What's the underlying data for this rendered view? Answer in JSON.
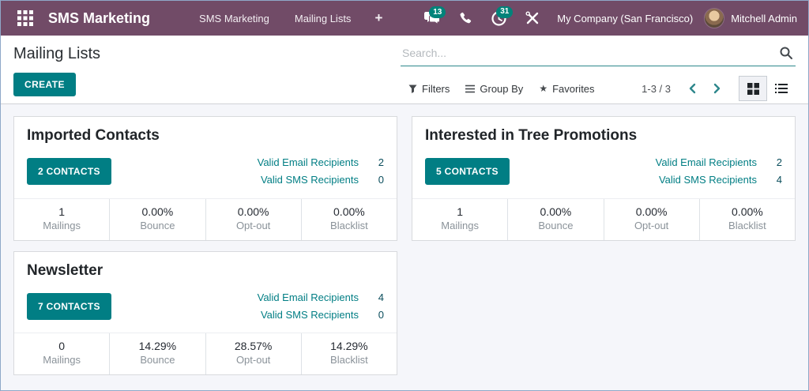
{
  "icons": {
    "plus": "+",
    "star": "★"
  },
  "colors": {
    "header_bg": "#714B67",
    "accent_teal": "#017E84",
    "badge_teal": "#00837A",
    "content_bg": "#F5F6FA"
  },
  "header": {
    "app_name": "SMS Marketing",
    "menu_items": [
      {
        "label": "SMS Marketing"
      },
      {
        "label": "Mailing Lists"
      }
    ],
    "messages_badge": "13",
    "activities_badge": "31",
    "company": "My Company (San Francisco)",
    "user": "Mitchell Admin"
  },
  "control_panel": {
    "title": "Mailing Lists",
    "create_label": "CREATE",
    "search_placeholder": "Search...",
    "filters_label": "Filters",
    "group_by_label": "Group By",
    "favorites_label": "Favorites",
    "pager": "1-3 / 3"
  },
  "cards": [
    {
      "title": "Imported Contacts",
      "contacts_label": "2 CONTACTS",
      "valid_email_label": "Valid Email Recipients",
      "valid_email_value": "2",
      "valid_sms_label": "Valid SMS Recipients",
      "valid_sms_value": "0",
      "stats": [
        {
          "value": "1",
          "label": "Mailings"
        },
        {
          "value": "0.00%",
          "label": "Bounce"
        },
        {
          "value": "0.00%",
          "label": "Opt-out"
        },
        {
          "value": "0.00%",
          "label": "Blacklist"
        }
      ]
    },
    {
      "title": "Interested in Tree Promotions",
      "contacts_label": "5 CONTACTS",
      "valid_email_label": "Valid Email Recipients",
      "valid_email_value": "2",
      "valid_sms_label": "Valid SMS Recipients",
      "valid_sms_value": "4",
      "stats": [
        {
          "value": "1",
          "label": "Mailings"
        },
        {
          "value": "0.00%",
          "label": "Bounce"
        },
        {
          "value": "0.00%",
          "label": "Opt-out"
        },
        {
          "value": "0.00%",
          "label": "Blacklist"
        }
      ]
    },
    {
      "title": "Newsletter",
      "contacts_label": "7 CONTACTS",
      "valid_email_label": "Valid Email Recipients",
      "valid_email_value": "4",
      "valid_sms_label": "Valid SMS Recipients",
      "valid_sms_value": "0",
      "stats": [
        {
          "value": "0",
          "label": "Mailings"
        },
        {
          "value": "14.29%",
          "label": "Bounce"
        },
        {
          "value": "28.57%",
          "label": "Opt-out"
        },
        {
          "value": "14.29%",
          "label": "Blacklist"
        }
      ]
    }
  ]
}
